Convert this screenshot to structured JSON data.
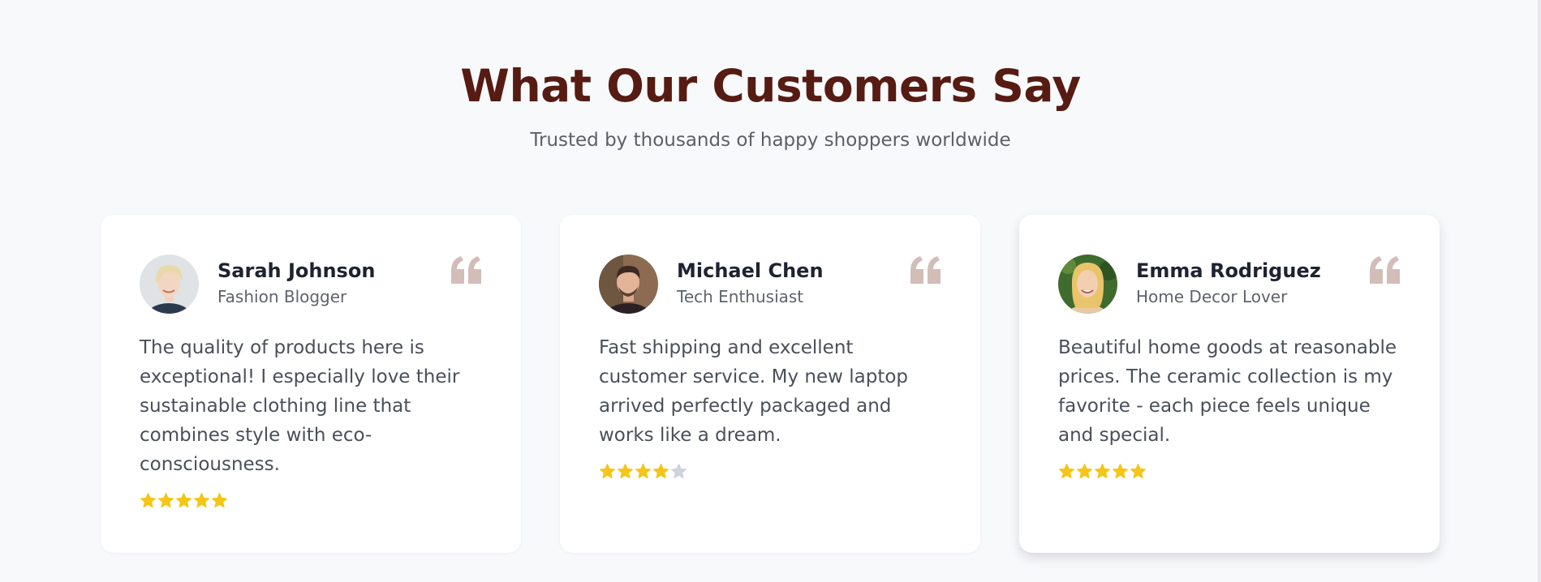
{
  "section": {
    "title": "What Our Customers Say",
    "subtitle": "Trusted by thousands of happy shoppers worldwide"
  },
  "colors": {
    "title": "#561b12",
    "star_filled": "#f5c518",
    "star_empty": "#cfd3dc",
    "quote_icon": "#d3bdb8"
  },
  "testimonials": [
    {
      "name": "Sarah Johnson",
      "role": "Fashion Blogger",
      "text": "The quality of products here is exceptional! I especially love their sustainable clothing line that combines style with eco-consciousness.",
      "rating": 5,
      "max_rating": 5,
      "quote_icon": "quote-icon"
    },
    {
      "name": "Michael Chen",
      "role": "Tech Enthusiast",
      "text": "Fast shipping and excellent customer service. My new laptop arrived perfectly packaged and works like a dream.",
      "rating": 4,
      "max_rating": 5,
      "quote_icon": "quote-icon"
    },
    {
      "name": "Emma Rodriguez",
      "role": "Home Decor Lover",
      "text": "Beautiful home goods at reasonable prices. The ceramic collection is my favorite - each piece feels unique and special.",
      "rating": 5,
      "max_rating": 5,
      "quote_icon": "quote-icon"
    }
  ]
}
